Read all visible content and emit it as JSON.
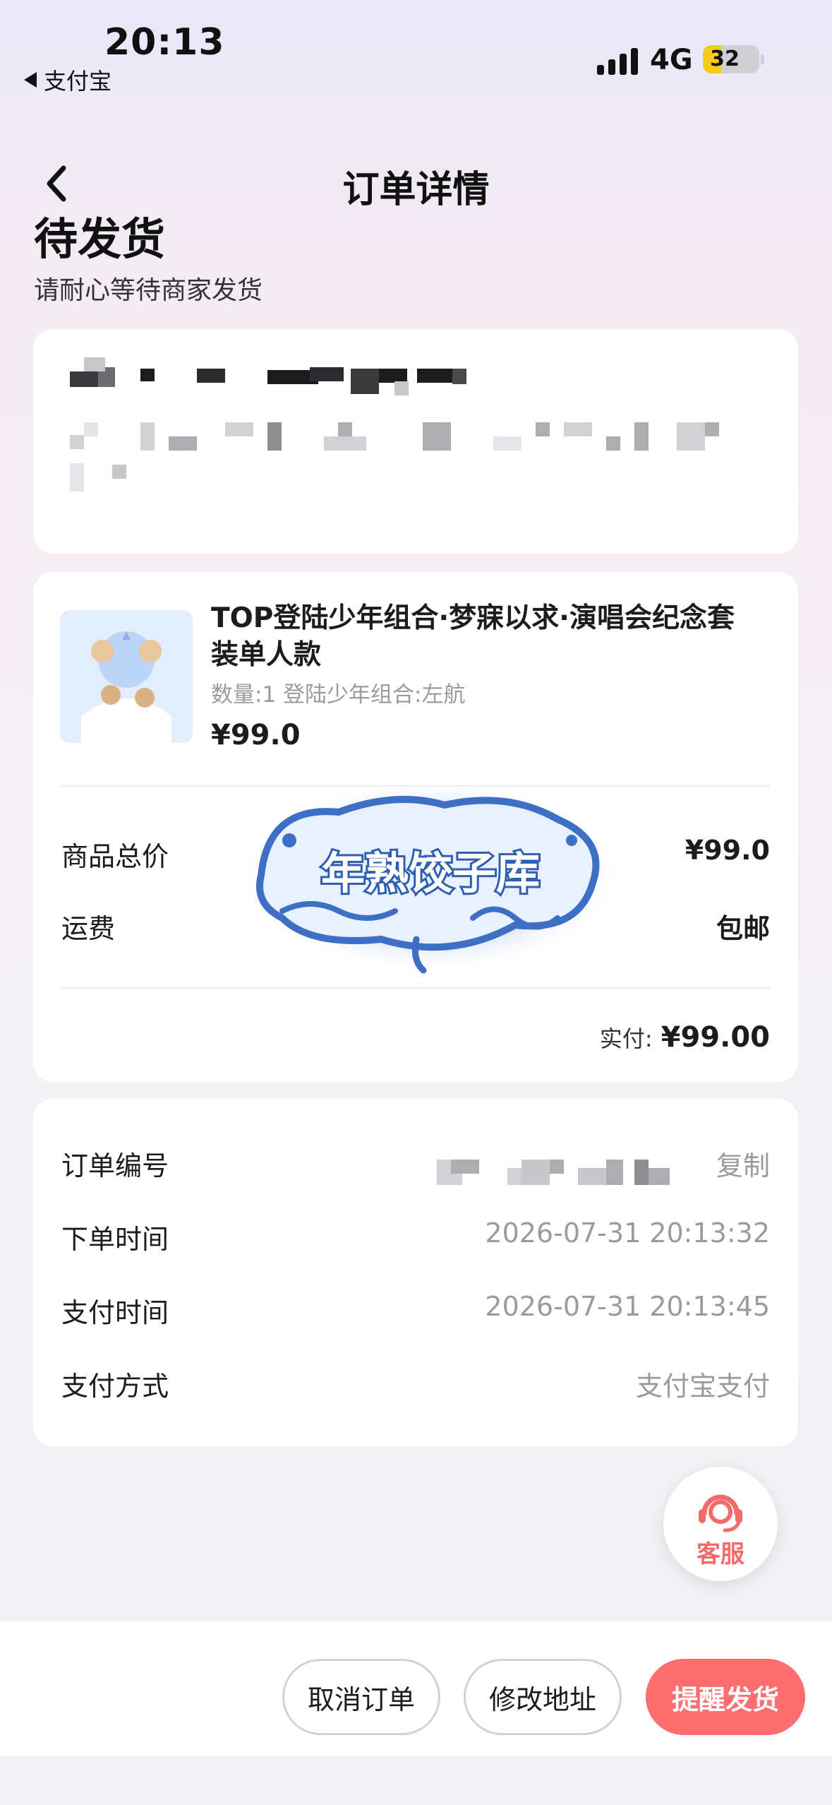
{
  "status_bar": {
    "time": "20:13",
    "back_app": "支付宝",
    "network": "4G",
    "battery": "32",
    "battery_level_percent": 32
  },
  "nav": {
    "title": "订单详情"
  },
  "order_status": {
    "title": "待发货",
    "subtitle": "请耐心等待商家发货"
  },
  "product": {
    "name": "TOP登陆少年组合·梦寐以求·演唱会纪念套装单人款",
    "spec": "数量:1 登陆少年组合:左航",
    "price": "¥99.0"
  },
  "summary": {
    "goods_total_label": "商品总价",
    "goods_total_value": "¥99.0",
    "shipping_label": "运费",
    "shipping_value": "包邮",
    "paid_label": "实付:",
    "paid_value": "¥99.00"
  },
  "info": {
    "order_no_label": "订单编号",
    "copy_label": "复制",
    "order_time_label": "下单时间",
    "order_time_value": "2026-07-31 20:13:32",
    "pay_time_label": "支付时间",
    "pay_time_value": "2026-07-31 20:13:45",
    "pay_method_label": "支付方式",
    "pay_method_value": "支付宝支付"
  },
  "watermark": {
    "text": "年熟饺子库"
  },
  "service": {
    "label": "客服",
    "icon": "headset-icon"
  },
  "actions": {
    "cancel": "取消订单",
    "modify_address": "修改地址",
    "remind_ship": "提醒发货"
  },
  "colors": {
    "accent": "#ff6e6e",
    "service_icon": "#f26a6a",
    "muted_text": "#9a9aa0"
  }
}
